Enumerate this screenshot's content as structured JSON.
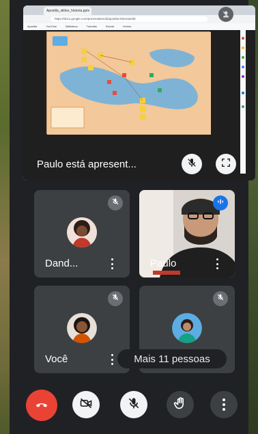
{
  "presentation": {
    "label": "Paulo está apresent...",
    "browser_tab": "Apostila_slides_historia.pptx",
    "url": "https://docs.google.com/presentation/d/apostila-historia/edit",
    "bookmarks": [
      "Apostila",
      "YouTube",
      "Biblioteca",
      "Tutoriais",
      "Escola",
      "Outros"
    ]
  },
  "participants": [
    {
      "name": "Dand...",
      "muted": true,
      "avatar_color": "#c0392b"
    },
    {
      "name": "Paulo",
      "muted": false,
      "speaking": true
    },
    {
      "name": "Você",
      "muted": true,
      "avatar_color": "#d35400"
    },
    {
      "name": "",
      "muted": true,
      "avatar_color": "#16a085"
    }
  ],
  "more_people": "Mais 11 pessoas",
  "colors": {
    "end_call": "#ea4335",
    "tile_bg": "#3c4043",
    "speaking_badge": "#1a73e8",
    "app_bg": "#202124"
  },
  "icons": {
    "end_call": "phone-hangup-icon",
    "camera": "camera-off-icon",
    "mic": "mic-off-icon",
    "raise_hand": "hand-icon",
    "more": "more-vert-icon",
    "fullscreen": "fullscreen-icon",
    "present_mic": "mic-off-icon"
  }
}
